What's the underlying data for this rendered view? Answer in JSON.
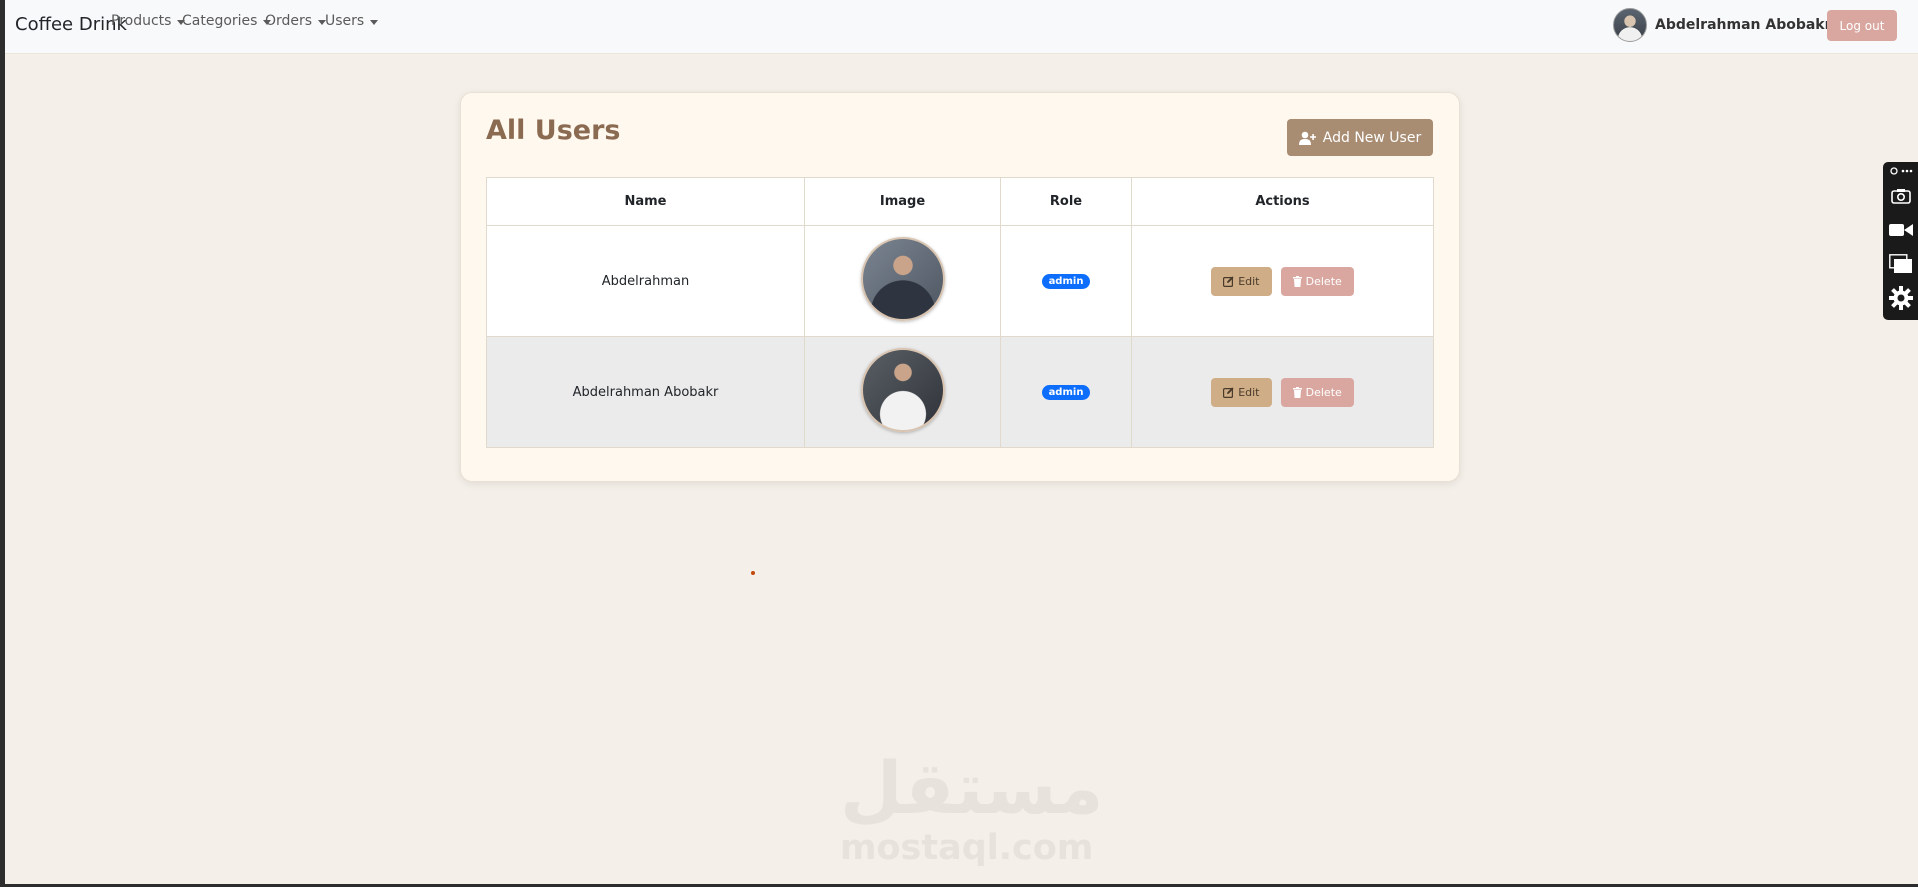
{
  "navbar": {
    "brand": "Coffee Drink",
    "menu": [
      {
        "label": "Products"
      },
      {
        "label": "Categories"
      },
      {
        "label": "Orders"
      },
      {
        "label": "Users"
      }
    ],
    "user_name": "Abdelrahman Abobakr",
    "logout_label": "Log out"
  },
  "page": {
    "title": "All Users",
    "add_button_label": "Add New User"
  },
  "table": {
    "headers": [
      "Name",
      "Image",
      "Role",
      "Actions"
    ],
    "rows": [
      {
        "name": "Abdelrahman",
        "role": "admin",
        "edit_label": "Edit",
        "delete_label": "Delete"
      },
      {
        "name": "Abdelrahman Abobakr",
        "role": "admin",
        "edit_label": "Edit",
        "delete_label": "Delete"
      }
    ]
  },
  "watermark": {
    "arabic": "مستقل",
    "latin": "mostaql.com"
  },
  "icons": {
    "add_user": "user-plus-icon",
    "edit": "edit-icon",
    "delete": "trash-icon",
    "dropdown": "caret-down-icon"
  },
  "colors": {
    "page_bg": "#f4efe8",
    "card_bg": "#fff8ef",
    "title": "#8b6a52",
    "add_button": "#a98d73",
    "edit_button": "#cfae87",
    "delete_button": "#d9a7a0",
    "logout_button": "#d9a7a0",
    "role_badge": "#0d6efd"
  }
}
